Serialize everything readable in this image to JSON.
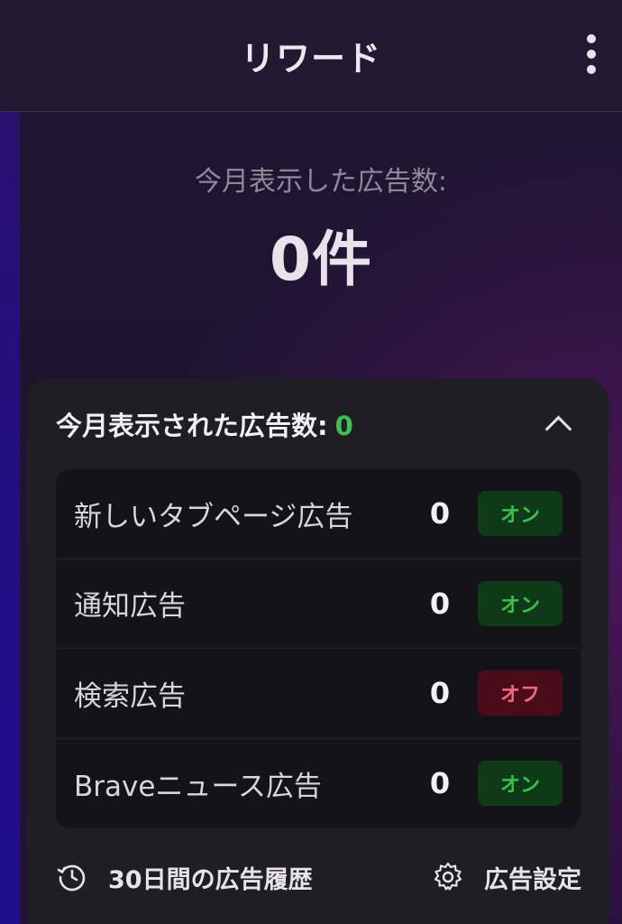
{
  "header": {
    "title": "リワード",
    "menu_icon": "kebab-menu-icon"
  },
  "summary": {
    "label": "今月表示した広告数:",
    "value": "0件"
  },
  "card": {
    "title": "今月表示された広告数:",
    "count": "0",
    "collapse_icon": "chevron-up-icon",
    "rows": [
      {
        "label": "新しいタブページ広告",
        "count": "0",
        "status": "オン",
        "state": "on"
      },
      {
        "label": "通知広告",
        "count": "0",
        "status": "オン",
        "state": "on"
      },
      {
        "label": "検索広告",
        "count": "0",
        "status": "オフ",
        "state": "off"
      },
      {
        "label": "Braveニュース広告",
        "count": "0",
        "status": "オン",
        "state": "on"
      }
    ],
    "footer": {
      "history_label": "30日間の広告履歴",
      "history_icon": "history-clock-icon",
      "settings_label": "広告設定",
      "settings_icon": "gear-icon"
    }
  },
  "colors": {
    "accent_green": "#3fbf4f",
    "on_badge_bg": "#0e3a17",
    "off_badge_bg": "#4a0c19",
    "off_badge_text": "#f06a7a"
  }
}
